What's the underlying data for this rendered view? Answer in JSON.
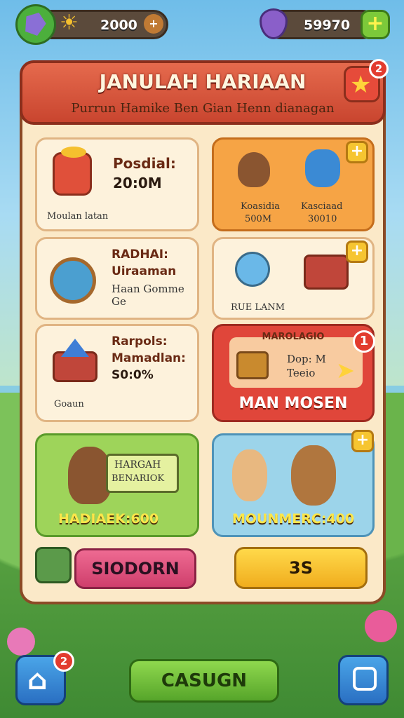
{
  "topbar": {
    "left_value": "2000",
    "right_value": "59970",
    "plus_label": "+"
  },
  "panel": {
    "title": "JANULAH HARIAAN",
    "subtitle": "Purrun Hamike Ben Gian Henn dianagan",
    "header_badge": "2"
  },
  "cards": {
    "c1": {
      "line1": "Posdial:",
      "line2": "20:0M",
      "caption": "Moulan latan"
    },
    "c2": {
      "left_label": "Koasidia",
      "left_value": "500M",
      "right_label": "Kasciaad",
      "right_value": "30010"
    },
    "c3": {
      "line1": "RADHAI:",
      "line2": "Uiraaman",
      "line3": "Haan Gomme Ge"
    },
    "c4": {
      "caption": "RUE LANM"
    },
    "c5": {
      "line1": "Rarpols:",
      "line2": "Mamadlan:",
      "line3": "S0:0%",
      "caption": "Goaun"
    },
    "c6": {
      "top": "MAROLAGIO",
      "mid1": "Dop: M",
      "mid2": "Teeio",
      "bottom": "MAN MOSEN",
      "badge": "1"
    },
    "c7": {
      "speech1": "HARGAH",
      "speech2": "BENARIOK",
      "footer": "HADIAEK:600"
    },
    "c8": {
      "footer": "MOUNMERC:400"
    }
  },
  "buttons": {
    "pink": "SIODORN",
    "yellow": "3S",
    "bottom": "CASUGN"
  },
  "bottom_nav": {
    "home_badge": "2"
  },
  "colors": {
    "header": "#d9533b",
    "panel": "#fbe9c8",
    "orange_card": "#f6a445",
    "red_card": "#e0463a",
    "green_card": "#9ed45a",
    "blue_card": "#9cd4ea",
    "pink_button": "#e4577f",
    "yellow_button": "#f8c331",
    "green_button": "#7cc93a"
  }
}
